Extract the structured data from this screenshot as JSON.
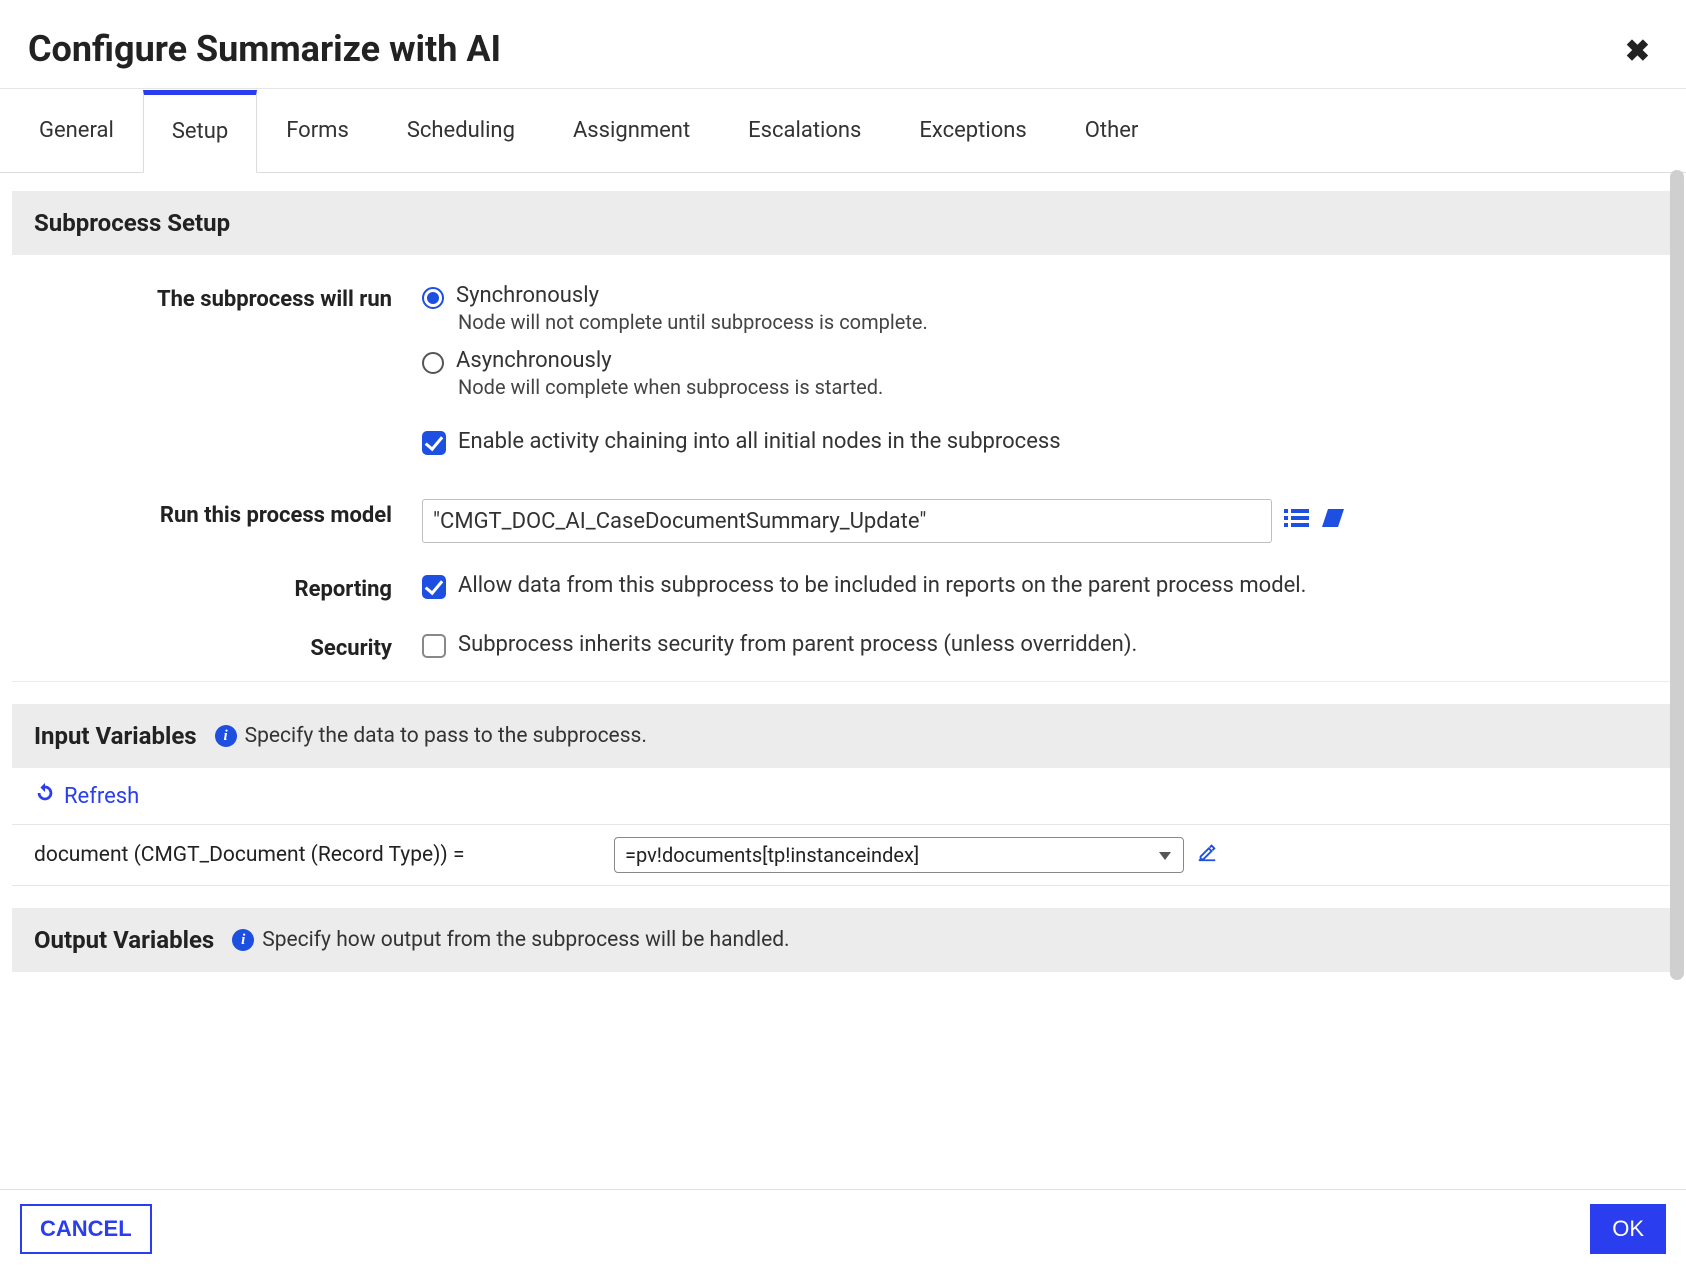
{
  "header": {
    "title": "Configure Summarize with AI"
  },
  "tabs": [
    "General",
    "Setup",
    "Forms",
    "Scheduling",
    "Assignment",
    "Escalations",
    "Exceptions",
    "Other"
  ],
  "active_tab_index": 1,
  "subprocess_setup": {
    "section_title": "Subprocess Setup",
    "run_label": "The subprocess will run",
    "sync": {
      "label": "Synchronously",
      "sub": "Node will not complete until subprocess is complete.",
      "selected": true
    },
    "async": {
      "label": "Asynchronously",
      "sub": "Node will complete when subprocess is started.",
      "selected": false
    },
    "chaining": {
      "label": "Enable activity chaining into all initial nodes in the subprocess",
      "checked": true
    },
    "process_model_label": "Run this process model",
    "process_model_value": "\"CMGT_DOC_AI_CaseDocumentSummary_Update\"",
    "reporting_label": "Reporting",
    "reporting": {
      "label": "Allow data from this subprocess to be included in reports on the parent process model.",
      "checked": true
    },
    "security_label": "Security",
    "security": {
      "label": "Subprocess inherits security from parent process (unless overridden).",
      "checked": false
    }
  },
  "input_vars": {
    "title": "Input Variables",
    "desc": "Specify the data to pass to the subprocess.",
    "refresh_label": "Refresh",
    "var_label": "document (CMGT_Document (Record Type)) =",
    "var_value": "=pv!documents[tp!instanceindex]"
  },
  "output_vars": {
    "title": "Output Variables",
    "desc": "Specify how output from the subprocess will be handled."
  },
  "footer": {
    "cancel": "CANCEL",
    "ok": "OK"
  }
}
